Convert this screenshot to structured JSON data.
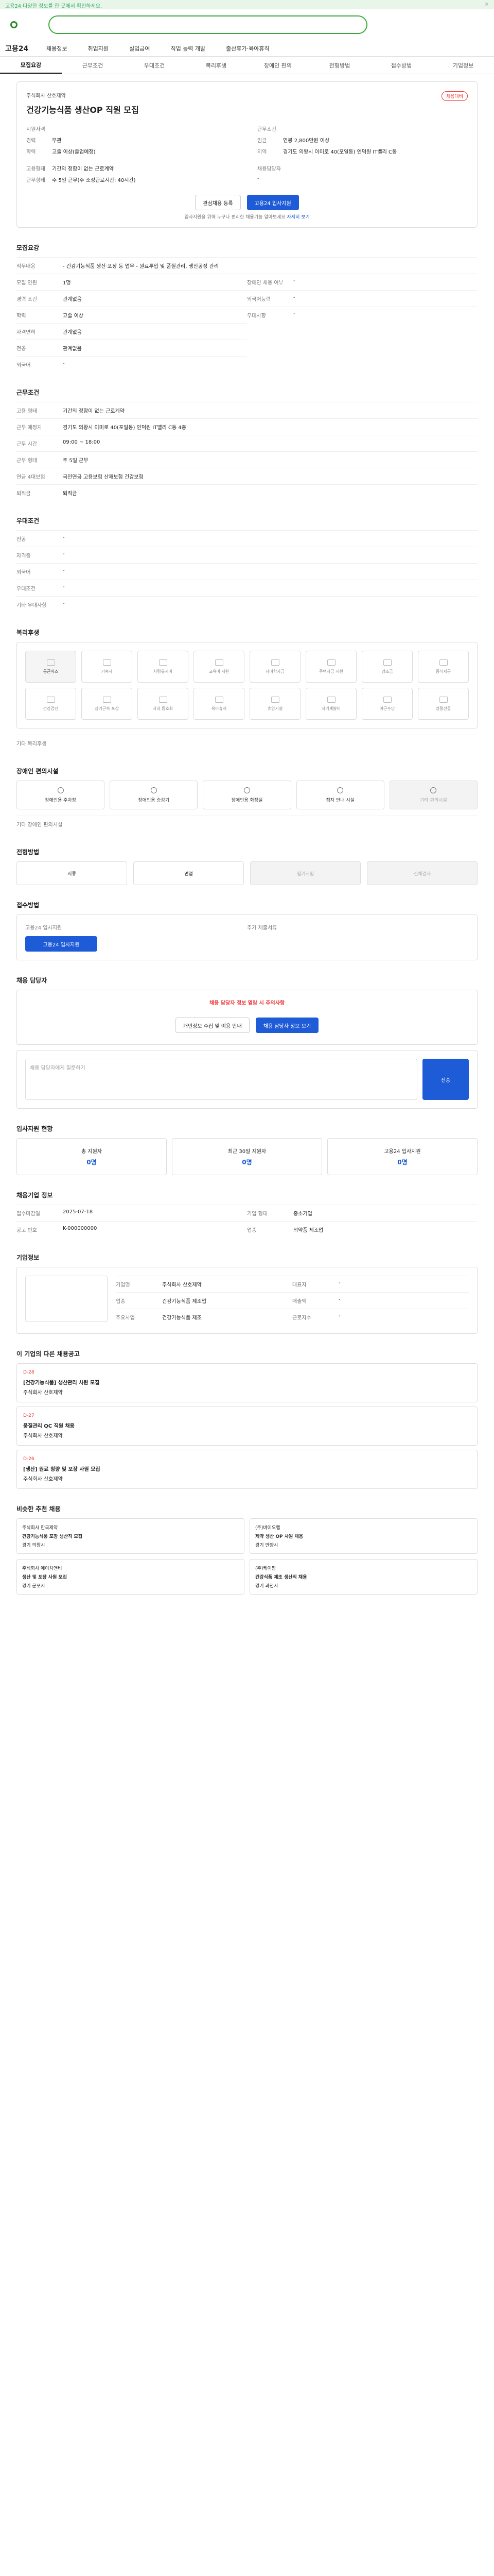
{
  "banner": {
    "text": "고용24 다양한 정보를 한 곳에서 확인하세요.",
    "close": "×"
  },
  "site": {
    "brand": "고용24"
  },
  "nav": [
    "채용정보",
    "취업지원",
    "실업급여",
    "직업 능력 개발",
    "출산휴가·육아휴직"
  ],
  "tabs": [
    "모집요강",
    "근무조건",
    "우대조건",
    "복리후생",
    "장애인 편의",
    "전형방법",
    "접수방법",
    "기업정보"
  ],
  "job": {
    "badge": "채용대비",
    "company": "주식회사 산호제약",
    "title": "건강기능식품 생산OP 직원 모집",
    "apply_label": "지원자격",
    "cond_label": "근무조건",
    "rows_left": [
      [
        "경력",
        "무관"
      ],
      [
        "학력",
        "고졸 이상(졸업예정)"
      ]
    ],
    "rows_right": [
      [
        "임금",
        "연봉 2,800만원 이상"
      ],
      [
        "지역",
        "경기도 의왕시 이미로 40(포일동) 인덕원 IT밸리 C동"
      ]
    ],
    "rows_left2": [
      [
        "고용형태",
        "기간의 정함이 없는 근로계약"
      ],
      [
        "근무형태",
        "주 5일 근무(주 소정근로시간: 40시간)"
      ]
    ],
    "contact_label": "채용담당자",
    "contact": [
      "-"
    ],
    "btn_interest": "관심채용 등록",
    "btn_apply": "고용24 입사지원",
    "notice": "입사지원을 위해 누구나 편리한 채용기능 알아보세요",
    "notice_link": "자세히 보기"
  },
  "recruit": {
    "h": "모집요강",
    "rows": [
      [
        "직무내용",
        "- 건강기능식품 생산·포장 등 업무 - 원료투입 및 품질관리, 생산공정 관리"
      ],
      [
        "모집 인원",
        "1명"
      ],
      [
        "경력 조건",
        "관계없음"
      ],
      [
        "학력",
        "고졸 이상"
      ],
      [
        "자격면허",
        "관계없음"
      ],
      [
        "전공",
        "관계없음"
      ],
      [
        "외국어",
        "-"
      ]
    ],
    "right": [
      [
        "장애인 채용 여부",
        "-"
      ],
      [
        "외국어능력",
        "-"
      ],
      [
        "우대사항",
        "-"
      ]
    ]
  },
  "work": {
    "h": "근무조건",
    "rows": [
      [
        "고용 형태",
        "기간의 정함이 없는 근로계약"
      ],
      [
        "근무 예정지",
        "경기도 의왕시 이미로 40(포일동) 인덕원 IT밸리 C동 4층"
      ],
      [
        "근무 시간",
        "09:00 ~ 18:00"
      ],
      [
        "근무 형태",
        "주 5일 근무"
      ],
      [
        "연금 4대보험",
        "국민연금 고용보험 산재보험 건강보험"
      ],
      [
        "퇴직금",
        "퇴직금"
      ]
    ]
  },
  "prefs": {
    "h": "우대조건",
    "rows": [
      [
        "전공",
        "-"
      ],
      [
        "자격증",
        "-"
      ],
      [
        "외국어",
        "-"
      ],
      [
        "우대조건",
        "-"
      ],
      [
        "기타 우대사항",
        "-"
      ]
    ]
  },
  "welfare": {
    "h": "복리후생",
    "items": [
      "통근버스",
      "기숙사",
      "차량유지비",
      "교육비 지원",
      "자녀학자금",
      "주택자금 지원",
      "경조금",
      "중식제공",
      "건강검진",
      "장기근속 포상",
      "사내 동호회",
      "육아휴직",
      "휴양시설",
      "자기계발비",
      "야근수당",
      "명절선물"
    ],
    "note": "기타 복리후생"
  },
  "disab": {
    "h": "장애인 편의시설",
    "items": [
      "장애인용 주차장",
      "장애인용 승강기",
      "장애인용 화장실",
      "점자 안내 시설",
      "기타 편의시설"
    ],
    "note": "기타 장애인 편의시설"
  },
  "screen": {
    "h": "전형방법",
    "steps": [
      "서류",
      "면접",
      "필기시험",
      "신체검사"
    ]
  },
  "receipt": {
    "h": "접수방법",
    "left": "고용24 입사지원",
    "right": "추가 제출서류",
    "btn": "고용24 입사지원"
  },
  "manager": {
    "h": "채용 담당자",
    "warn": "채용 담당자 정보 열람 시 주의사항",
    "b1": "채용 담당자 정보 보기",
    "b2": "개인정보 수집 및 이용 안내",
    "inquiry": "채용 담당자에게 질문하기",
    "send": "전송"
  },
  "status": {
    "h": "입사지원 현황",
    "items": [
      [
        "총 지원자",
        "0명"
      ],
      [
        "최근 30일 지원자",
        "0명"
      ],
      [
        "고용24 입사지원",
        "0명"
      ]
    ]
  },
  "info": {
    "h": "채용기업 정보",
    "rows": [
      [
        "접수마감일",
        "2025-07-18"
      ],
      [
        "기업 형태",
        "중소기업"
      ],
      [
        "공고 번호",
        "K-000000000"
      ],
      [
        "업종",
        "의약품 제조업"
      ]
    ]
  },
  "company": {
    "h": "기업정보",
    "rows": [
      [
        "기업명",
        "주식회사 산호제약"
      ],
      [
        "대표자",
        "-"
      ],
      [
        "업종",
        "건강기능식품 제조업"
      ],
      [
        "매출액",
        "-"
      ],
      [
        "주요사업",
        "건강기능식품 제조"
      ],
      [
        "근로자수",
        "-"
      ]
    ]
  },
  "other": {
    "h": "이 기업의 다른 채용공고",
    "items": [
      {
        "d": "D-28",
        "t": "[건강기능식품] 생산관리 사원 모집",
        "c": "주식회사 산호제약"
      },
      {
        "d": "D-27",
        "t": "품질관리 QC 직원 채용",
        "c": "주식회사 산호제약"
      },
      {
        "d": "D-26",
        "t": "[생산] 원료 칭량 및 포장 사원 모집",
        "c": "주식회사 산호제약"
      }
    ]
  },
  "recs": {
    "h": "비슷한 추천 채용",
    "items": [
      {
        "c": "주식회사 한국제약",
        "t": "건강기능식품 포장 생산직 모집",
        "w": "경기 의왕시"
      },
      {
        "c": "(주)바이오랩",
        "t": "제약 생산 OP 사원 채용",
        "w": "경기 안양시"
      },
      {
        "c": "주식회사 에이치앤비",
        "t": "생산 및 포장 사원 모집",
        "w": "경기 군포시"
      },
      {
        "c": "(주)케이팜",
        "t": "건강식품 제조 생산직 채용",
        "w": "경기 과천시"
      }
    ]
  }
}
